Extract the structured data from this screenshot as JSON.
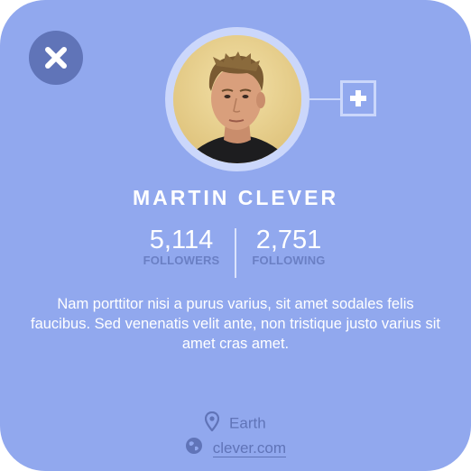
{
  "profile": {
    "name": "MARTIN CLEVER",
    "followers_count": "5,114",
    "followers_label": "FOLLOWERS",
    "following_count": "2,751",
    "following_label": "FOLLOWING",
    "bio": "Nam porttitor nisi a purus varius, sit amet sodales felis faucibus. Sed venenatis velit ante, non tristique justo varius sit amet cras amet.",
    "location": "Earth",
    "website": "clever.com"
  },
  "icons": {
    "close": "close-icon",
    "add": "plus-icon",
    "location": "map-pin-icon",
    "website": "globe-icon"
  },
  "colors": {
    "card_background": "#91a8ee",
    "accent_dark": "#6074b8",
    "ring": "#cbd7fb",
    "text_light": "#ffffff"
  }
}
